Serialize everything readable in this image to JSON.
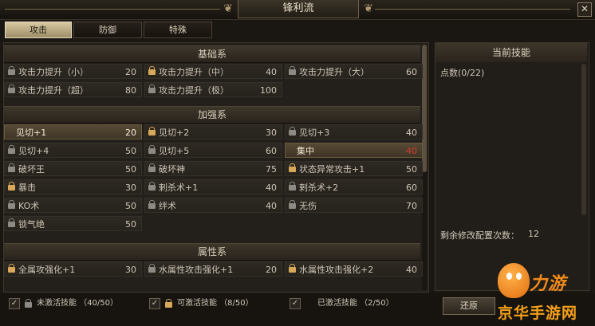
{
  "window": {
    "title": "锋利流",
    "close_label": "✕"
  },
  "tabs": [
    {
      "label": "攻击",
      "active": true
    },
    {
      "label": "防御",
      "active": false
    },
    {
      "label": "特殊",
      "active": false
    }
  ],
  "sections": {
    "basic": {
      "title": "基础系",
      "skills": [
        {
          "name": "攻击力提升（小）",
          "value": "20",
          "lock": "grey"
        },
        {
          "name": "攻击力提升（中）",
          "value": "40",
          "lock": "gold"
        },
        {
          "name": "攻击力提升（大）",
          "value": "60",
          "lock": "grey"
        },
        {
          "name": "攻击力提升（超）",
          "value": "80",
          "lock": "grey"
        },
        {
          "name": "攻击力提升（极）",
          "value": "100",
          "lock": "grey"
        }
      ]
    },
    "enhance": {
      "title": "加强系",
      "skills": [
        {
          "name": "见切+1",
          "value": "20",
          "lock": "none",
          "lit": true
        },
        {
          "name": "见切+2",
          "value": "30",
          "lock": "gold"
        },
        {
          "name": "见切+3",
          "value": "40",
          "lock": "grey"
        },
        {
          "name": "见切+4",
          "value": "50",
          "lock": "grey"
        },
        {
          "name": "见切+5",
          "value": "60",
          "lock": "grey"
        },
        {
          "name": "集中",
          "value": "40",
          "lock": "none",
          "lit": true,
          "value_color": "#d23a2a"
        },
        {
          "name": "破坏王",
          "value": "50",
          "lock": "grey"
        },
        {
          "name": "破坏神",
          "value": "75",
          "lock": "grey"
        },
        {
          "name": "状态异常攻击+1",
          "value": "50",
          "lock": "gold"
        },
        {
          "name": "暴击",
          "value": "30",
          "lock": "gold"
        },
        {
          "name": "剌杀术+1",
          "value": "40",
          "lock": "grey"
        },
        {
          "name": "剌杀术+2",
          "value": "60",
          "lock": "grey"
        },
        {
          "name": "KO术",
          "value": "50",
          "lock": "grey"
        },
        {
          "name": "绊术",
          "value": "40",
          "lock": "grey"
        },
        {
          "name": "无伤",
          "value": "70",
          "lock": "grey"
        },
        {
          "name": "锁气绝",
          "value": "50",
          "lock": "grey"
        }
      ]
    },
    "attribute": {
      "title": "属性系",
      "skills": [
        {
          "name": "全属攻强化+1",
          "value": "30",
          "lock": "gold"
        },
        {
          "name": "水属性攻击强化+1",
          "value": "20",
          "lock": "grey"
        },
        {
          "name": "水属性攻击强化+2",
          "value": "40",
          "lock": "gold"
        }
      ]
    }
  },
  "current_skills": {
    "title": "当前技能",
    "points": "点数(0/22)",
    "remaining_label": "剩余修改配置次数：",
    "remaining_value": "12"
  },
  "footer": {
    "legend": [
      {
        "text": "未激活技能 （40/50）",
        "lock": "grey"
      },
      {
        "text": "可激活技能 （8/50）",
        "lock": "gold"
      },
      {
        "text": "已激活技能 （2/50）",
        "lock": "none"
      }
    ],
    "reset_label": "还原"
  },
  "watermark": {
    "line1": "力游",
    "line2": "京华手游网"
  },
  "colors": {
    "accent_gold": "#d7a85a",
    "lock_grey": "#8d8a84",
    "warn_red": "#d23a2a",
    "tab_active": "#cfc09a"
  }
}
